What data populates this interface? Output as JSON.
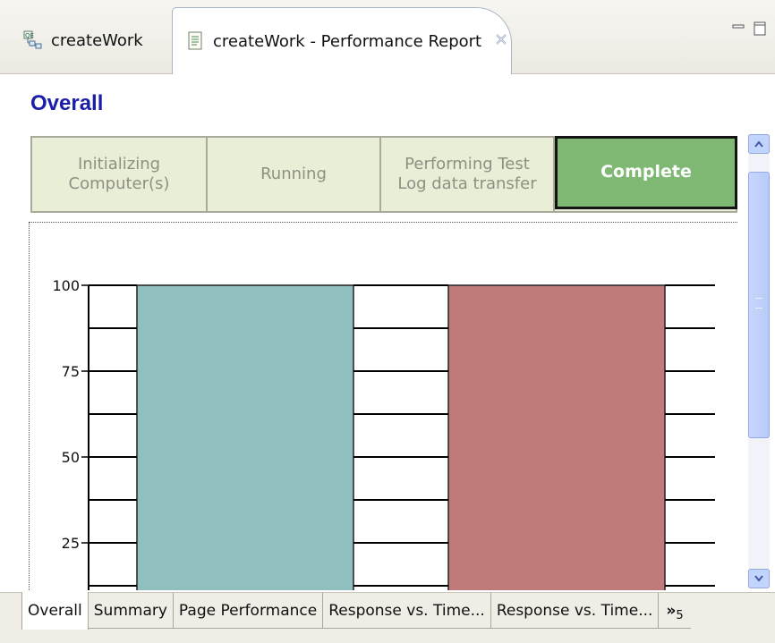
{
  "tabs": [
    {
      "label": "createWork",
      "icon": "schedule-icon"
    },
    {
      "label": "createWork - Performance Report",
      "icon": "report-icon",
      "close": "X"
    }
  ],
  "report": {
    "title": "Overall",
    "stages": [
      {
        "label": "Initializing Computer(s)",
        "state": "inactive"
      },
      {
        "label": "Running",
        "state": "inactive"
      },
      {
        "label": "Performing Test Log data transfer",
        "state": "inactive"
      },
      {
        "label": "Complete",
        "state": "active"
      }
    ]
  },
  "chart_data": {
    "type": "bar",
    "categories": [
      "",
      ""
    ],
    "values": [
      100,
      100
    ],
    "colors": [
      "#8fbfbf",
      "#c07a7a"
    ],
    "y_ticks": [
      "25",
      "50",
      "75",
      "100"
    ],
    "ylim": [
      25,
      100
    ],
    "grid": true
  },
  "bottom_tabs": {
    "items": [
      "Overall",
      "Summary",
      "Page Performance",
      "Response vs. Time...",
      "Response vs. Time..."
    ],
    "more_label": "»",
    "more_count": "5"
  },
  "colors": {
    "title": "#1b1ea8",
    "complete_bg": "#7fb873",
    "stage_bg": "#e9efd7"
  }
}
